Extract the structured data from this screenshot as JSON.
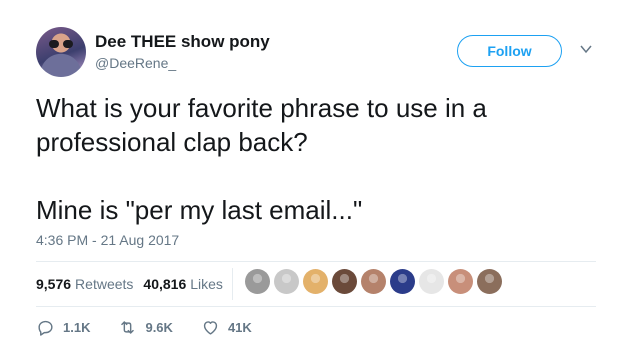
{
  "author": {
    "display_name": "Dee THEE show pony",
    "handle": "@DeeRene_"
  },
  "follow_label": "Follow",
  "tweet": {
    "line_1": "What is your favorite phrase to use in a professional clap back?",
    "line_2": "Mine is \"per my last email...\"",
    "timestamp": "4:36 PM - 21 Aug 2017"
  },
  "stats": {
    "retweets_count": "9,576",
    "retweets_label": "Retweets",
    "likes_count": "40,816",
    "likes_label": "Likes"
  },
  "actions": {
    "reply_count": "1.1K",
    "retweet_count": "9.6K",
    "like_count": "41K"
  },
  "colors": {
    "accent": "#1da1f2",
    "secondary_text": "#657786",
    "primary_text": "#14171a"
  },
  "liker_avatars": [
    {
      "icon": "liker-avatar-1",
      "color": "#9a9a9a"
    },
    {
      "icon": "liker-avatar-2",
      "color": "#c8c8c8"
    },
    {
      "icon": "liker-avatar-3",
      "color": "#e3b16a"
    },
    {
      "icon": "liker-avatar-4",
      "color": "#6b4a3a"
    },
    {
      "icon": "liker-avatar-5",
      "color": "#b5826b"
    },
    {
      "icon": "liker-avatar-6",
      "color": "#2b3c8a"
    },
    {
      "icon": "liker-avatar-7",
      "color": "#e6e6e6"
    },
    {
      "icon": "liker-avatar-8",
      "color": "#c88f7a"
    },
    {
      "icon": "liker-avatar-9",
      "color": "#8b6e5c"
    }
  ]
}
